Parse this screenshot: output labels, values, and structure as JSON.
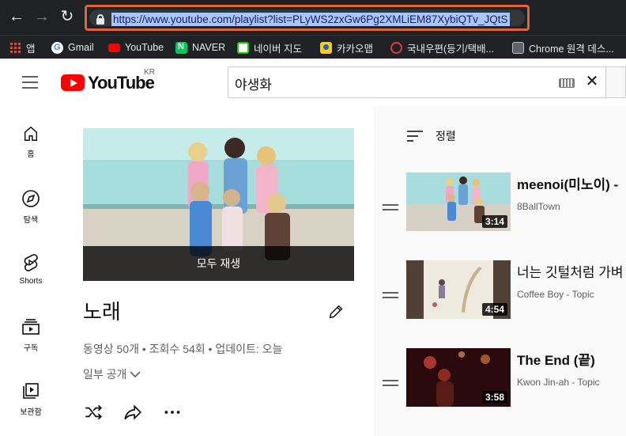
{
  "browser": {
    "url": "https://www.youtube.com/playlist?list=PLyWS2zxGw6Pg2XMLiEM87XybiQTv_JQtS",
    "bookmarks": [
      {
        "label": "앱",
        "icon": "apps-grid-icon",
        "color": "#ea4335"
      },
      {
        "label": "Gmail",
        "icon": "google-icon",
        "color": "#ffffff"
      },
      {
        "label": "YouTube",
        "icon": "youtube-icon",
        "color": "#ff0000"
      },
      {
        "label": "NAVER",
        "icon": "naver-icon",
        "color": "#03c75a"
      },
      {
        "label": "네이버 지도",
        "icon": "naver-map-icon",
        "color": "#1ec800"
      },
      {
        "label": "카카오맵",
        "icon": "kakaomap-icon",
        "color": "#ffcd00"
      },
      {
        "label": "국내우편(등기/택배...",
        "icon": "post-icon",
        "color": "#e53935"
      },
      {
        "label": "Chrome 원격 데스...",
        "icon": "chrome-remote-icon",
        "color": "#9aa0a6"
      }
    ]
  },
  "header": {
    "logo_text": "YouTube",
    "region": "KR",
    "search_value": "야생화"
  },
  "sidebar": {
    "items": [
      {
        "label": "홈",
        "icon": "home-icon"
      },
      {
        "label": "탐색",
        "icon": "explore-icon"
      },
      {
        "label": "Shorts",
        "icon": "shorts-icon"
      },
      {
        "label": "구독",
        "icon": "subscriptions-icon"
      },
      {
        "label": "보관함",
        "icon": "library-icon"
      }
    ]
  },
  "playlist": {
    "play_all": "모두 재생",
    "title": "노래",
    "stats": "동영상 50개 • 조회수 54회 • 업데이트: 오늘",
    "privacy": "일부 공개"
  },
  "list": {
    "sort_label": "정렬",
    "items": [
      {
        "title": "meenoi(미노이) - ",
        "channel": "8BallTown",
        "duration": "3:14"
      },
      {
        "title": "너는 깃털처럼 가벼",
        "channel": "Coffee Boy - Topic",
        "duration": "4:54"
      },
      {
        "title": "The End (끝)",
        "channel": "Kwon Jin-ah - Topic",
        "duration": "3:58"
      }
    ]
  },
  "colors": {
    "brand_red": "#ff0000",
    "url_highlight": "#a8c7fa",
    "url_outline": "#e0623f"
  }
}
